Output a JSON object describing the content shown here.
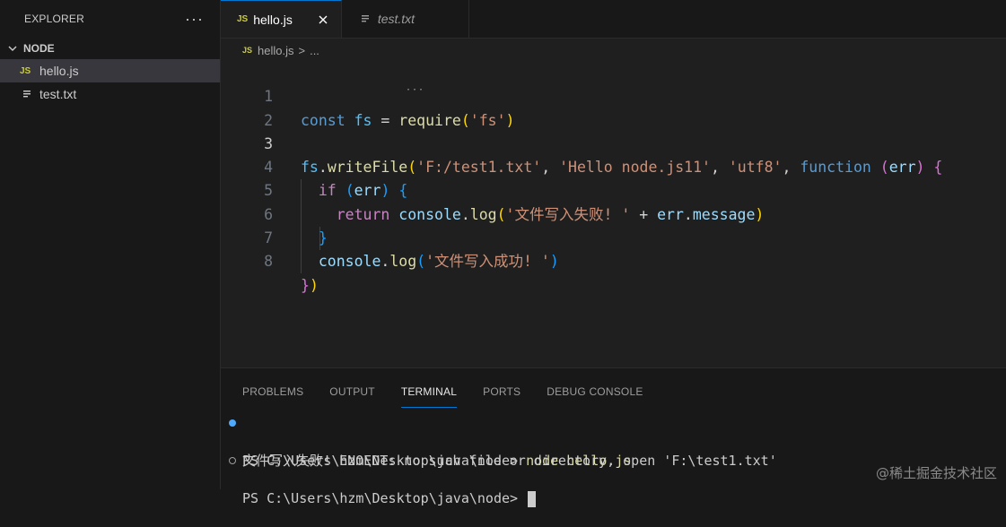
{
  "explorer": {
    "title": "EXPLORER",
    "more_label": "···",
    "folder": "NODE",
    "files": [
      {
        "name": "hello.js",
        "type": "js",
        "active": true
      },
      {
        "name": "test.txt",
        "type": "txt",
        "active": false
      }
    ]
  },
  "tabs": [
    {
      "label": "hello.js",
      "icon": "JS",
      "active": true
    },
    {
      "label": "test.txt",
      "active": false
    }
  ],
  "breadcrumb": {
    "icon": "JS",
    "file": "hello.js",
    "separator": ">",
    "rest": "..."
  },
  "editor": {
    "line_numbers": [
      "1",
      "2",
      "3",
      "4",
      "5",
      "6",
      "7",
      "8"
    ],
    "current_line": "3"
  },
  "panel": {
    "tabs": [
      "PROBLEMS",
      "OUTPUT",
      "TERMINAL",
      "PORTS",
      "DEBUG CONSOLE"
    ],
    "active_tab": "TERMINAL",
    "terminal": {
      "prompt1": "PS C:\\Users\\hzm\\Desktop\\java\\node> ",
      "command1": "node hello.js",
      "output": "文件写入失败! ENOENT: no such file or directory, open 'F:\\test1.txt'",
      "prompt2": "PS C:\\Users\\hzm\\Desktop\\java\\node> "
    }
  },
  "watermark": "@稀土掘金技术社区",
  "colors": {
    "accent": "#0078d4",
    "js_badge": "#cbcb41",
    "terminal_dot": "#4daafc"
  }
}
